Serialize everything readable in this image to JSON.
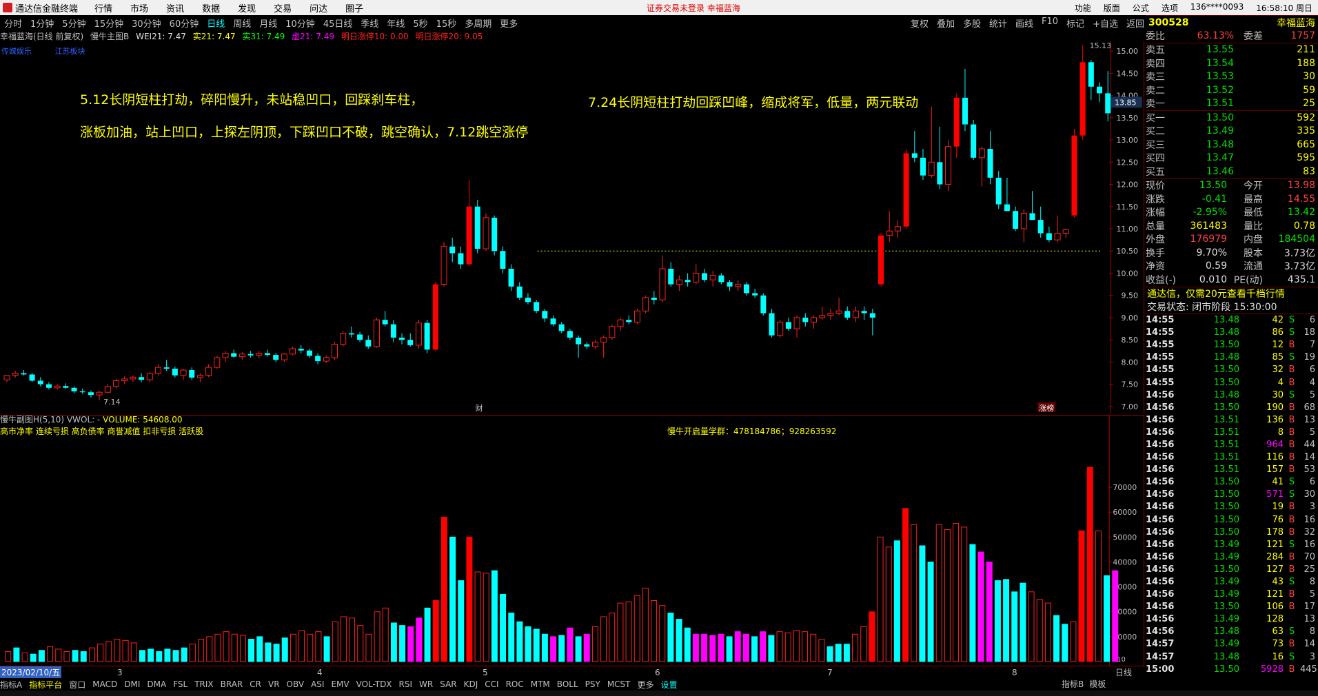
{
  "titlebar": {
    "app": "通达信金融终端",
    "menus": [
      "行情",
      "市场",
      "资讯",
      "数据",
      "发现",
      "交易",
      "问达",
      "圈子"
    ],
    "notice": "证券交易未登录  幸福蓝海",
    "right": [
      "功能",
      "版面",
      "公式",
      "选项",
      "136****0093",
      "16:58:10 周日"
    ]
  },
  "toolbar": {
    "periods": [
      "分时",
      "1分钟",
      "5分钟",
      "15分钟",
      "30分钟",
      "60分钟",
      "日线",
      "周线",
      "月线",
      "10分钟",
      "45日线",
      "季线",
      "年线",
      "5秒",
      "15秒",
      "多周期",
      "更多"
    ],
    "active": "日线",
    "right": [
      "复权",
      "叠加",
      "多股",
      "统计",
      "画线",
      "F10",
      "标记",
      "+自选",
      "返回"
    ]
  },
  "chart_info": {
    "name": "幸福蓝海(日线 前复权)",
    "indicator": "慢牛主图B",
    "wei21": "WEI21: 7.47",
    "shi21": "实21: 7.47",
    "shi31": "实31: 7.49",
    "xu21": "虚21: 7.49",
    "zt10": "明日涨停10: 0.00",
    "zt20": "明日涨停20: 9.05",
    "tags": [
      "传媒娱乐",
      "江苏板块"
    ]
  },
  "annotations": {
    "a1": "5.12长阴短柱打劫，碎阳慢升，未站稳凹口，回踩刹车柱，",
    "a2": "涨板加油，站上凹口，上探左阴顶，下踩凹口不破，跳空确认，7.12跳空涨停",
    "a3": "7.24长阴短柱打劫回踩凹峰，缩成将军，低量，两元联动"
  },
  "main_axis": {
    "ticks": [
      "15.00",
      "14.50",
      "14.00",
      "13.50",
      "13.00",
      "12.50",
      "12.00",
      "11.50",
      "11.00",
      "10.50",
      "10.00",
      "9.50",
      "9.00",
      "8.50",
      "8.00",
      "7.50",
      "7.00"
    ],
    "current_price_label": "13.85",
    "high_label": "15.13",
    "low_label": "7.14",
    "marker_cai": "财",
    "marker_zhangbang": "涨榜"
  },
  "sub_chart": {
    "title": "慢牛副图H(5,10)",
    "vol_label": "VWOL: -",
    "volume_label": "VOLUME: 54608.00",
    "line2": "高市净率 连续亏损 高负债率 商誉减值 扣非亏损 活跃股",
    "qq": "慢牛开启量学群：478184786；928263592",
    "ticks": [
      "70000",
      "60000",
      "50000",
      "40000",
      "30000",
      "20000",
      "10000"
    ],
    "unit": "X10"
  },
  "date_bar": {
    "current": "2023/02/10/五",
    "months": [
      "3",
      "4",
      "5",
      "6",
      "7",
      "8"
    ]
  },
  "indicator_tabs": [
    "指标A",
    "指标平台",
    "窗口",
    "MACD",
    "DMI",
    "DMA",
    "FSL",
    "TRIX",
    "BRAR",
    "CR",
    "VR",
    "OBV",
    "ASI",
    "EMV",
    "VOL-TDX",
    "RSI",
    "WR",
    "SAR",
    "KDJ",
    "CCI",
    "ROC",
    "MTM",
    "BOLL",
    "PSY",
    "MCST",
    "更多",
    "设置"
  ],
  "indicator_tabs_right": [
    "指标B",
    "模板",
    "日线"
  ],
  "quote": {
    "code": "300528",
    "name": "幸福蓝海",
    "weibi_label": "委比",
    "weibi": "63.13%",
    "weicha_label": "委差",
    "weicha": "1757",
    "asks": [
      {
        "label": "卖五",
        "price": "13.55",
        "vol": "211"
      },
      {
        "label": "卖四",
        "price": "13.54",
        "vol": "188"
      },
      {
        "label": "卖三",
        "price": "13.53",
        "vol": "30"
      },
      {
        "label": "卖二",
        "price": "13.52",
        "vol": "59"
      },
      {
        "label": "卖一",
        "price": "13.51",
        "vol": "25"
      }
    ],
    "bids": [
      {
        "label": "买一",
        "price": "13.50",
        "vol": "592"
      },
      {
        "label": "买二",
        "price": "13.49",
        "vol": "335"
      },
      {
        "label": "买三",
        "price": "13.48",
        "vol": "665"
      },
      {
        "label": "买四",
        "price": "13.47",
        "vol": "595"
      },
      {
        "label": "买五",
        "price": "13.46",
        "vol": "83"
      }
    ],
    "stats": [
      {
        "l1": "现价",
        "v1": "13.50",
        "l2": "今开",
        "v2": "13.98"
      },
      {
        "l1": "涨跌",
        "v1": "-0.41",
        "l2": "最高",
        "v2": "14.55"
      },
      {
        "l1": "涨幅",
        "v1": "-2.95%",
        "l2": "最低",
        "v2": "13.42"
      },
      {
        "l1": "总量",
        "v1": "361483",
        "l2": "量比",
        "v2": "0.78"
      },
      {
        "l1": "外盘",
        "v1": "176979",
        "l2": "内盘",
        "v2": "184504"
      },
      {
        "l1": "换手",
        "v1": "9.70%",
        "l2": "股本",
        "v2": "3.73亿"
      },
      {
        "l1": "净资",
        "v1": "0.59",
        "l2": "流通",
        "v2": "3.73亿"
      },
      {
        "l1": "收益(-)",
        "v1": "0.010",
        "l2": "PE(动)",
        "v2": "435.1"
      }
    ],
    "promo": "通达信，仅需20元查看千档行情",
    "trade_status": "交易状态: 闭市阶段 15:30:00"
  },
  "ticks": [
    {
      "t": "14:55",
      "p": "13.48",
      "v": "42",
      "bs": "S",
      "n": "6"
    },
    {
      "t": "14:55",
      "p": "13.48",
      "v": "86",
      "bs": "S",
      "n": "18"
    },
    {
      "t": "14:55",
      "p": "13.50",
      "v": "12",
      "bs": "B",
      "n": "7"
    },
    {
      "t": "14:55",
      "p": "13.48",
      "v": "85",
      "bs": "S",
      "n": "19"
    },
    {
      "t": "14:55",
      "p": "13.50",
      "v": "32",
      "bs": "B",
      "n": "6"
    },
    {
      "t": "14:55",
      "p": "13.50",
      "v": "4",
      "bs": "B",
      "n": "4"
    },
    {
      "t": "14:56",
      "p": "13.48",
      "v": "30",
      "bs": "S",
      "n": "5"
    },
    {
      "t": "14:56",
      "p": "13.50",
      "v": "190",
      "bs": "B",
      "n": "68"
    },
    {
      "t": "14:56",
      "p": "13.51",
      "v": "136",
      "bs": "B",
      "n": "13"
    },
    {
      "t": "14:56",
      "p": "13.51",
      "v": "8",
      "bs": "B",
      "n": "5"
    },
    {
      "t": "14:56",
      "p": "13.51",
      "v": "964",
      "bs": "B",
      "n": "44"
    },
    {
      "t": "14:56",
      "p": "13.51",
      "v": "116",
      "bs": "B",
      "n": "14"
    },
    {
      "t": "14:56",
      "p": "13.51",
      "v": "157",
      "bs": "B",
      "n": "53"
    },
    {
      "t": "14:56",
      "p": "13.50",
      "v": "41",
      "bs": "S",
      "n": "6"
    },
    {
      "t": "14:56",
      "p": "13.50",
      "v": "571",
      "bs": "S",
      "n": "30"
    },
    {
      "t": "14:56",
      "p": "13.50",
      "v": "19",
      "bs": "B",
      "n": "3"
    },
    {
      "t": "14:56",
      "p": "13.50",
      "v": "76",
      "bs": "B",
      "n": "16"
    },
    {
      "t": "14:56",
      "p": "13.50",
      "v": "178",
      "bs": "B",
      "n": "32"
    },
    {
      "t": "14:56",
      "p": "13.49",
      "v": "121",
      "bs": "S",
      "n": "16"
    },
    {
      "t": "14:56",
      "p": "13.49",
      "v": "284",
      "bs": "B",
      "n": "70"
    },
    {
      "t": "14:56",
      "p": "13.50",
      "v": "127",
      "bs": "B",
      "n": "25"
    },
    {
      "t": "14:56",
      "p": "13.49",
      "v": "43",
      "bs": "S",
      "n": "8"
    },
    {
      "t": "14:56",
      "p": "13.49",
      "v": "121",
      "bs": "B",
      "n": "5"
    },
    {
      "t": "14:56",
      "p": "13.50",
      "v": "106",
      "bs": "B",
      "n": "17"
    },
    {
      "t": "14:56",
      "p": "13.49",
      "v": "128",
      "bs": "",
      "n": "13"
    },
    {
      "t": "14:56",
      "p": "13.48",
      "v": "63",
      "bs": "S",
      "n": "8"
    },
    {
      "t": "14:57",
      "p": "13.49",
      "v": "73",
      "bs": "B",
      "n": "14"
    },
    {
      "t": "14:57",
      "p": "13.48",
      "v": "16",
      "bs": "S",
      "n": "3"
    },
    {
      "t": "15:00",
      "p": "13.50",
      "v": "5928",
      "bs": "B",
      "n": "445"
    }
  ],
  "colors": {
    "up": "#ff2020",
    "down": "#00ffff",
    "mag": "#ff00ff"
  },
  "candles": [
    [
      7.6,
      7.7,
      7.55,
      7.7
    ],
    [
      7.7,
      7.8,
      7.65,
      7.75
    ],
    [
      7.75,
      7.82,
      7.7,
      7.72
    ],
    [
      7.72,
      7.75,
      7.55,
      7.58
    ],
    [
      7.58,
      7.66,
      7.45,
      7.5
    ],
    [
      7.5,
      7.55,
      7.38,
      7.42
    ],
    [
      7.42,
      7.5,
      7.38,
      7.46
    ],
    [
      7.46,
      7.52,
      7.4,
      7.42
    ],
    [
      7.42,
      7.45,
      7.3,
      7.34
    ],
    [
      7.34,
      7.4,
      7.28,
      7.32
    ],
    [
      7.32,
      7.36,
      7.2,
      7.26
    ],
    [
      7.26,
      7.35,
      7.14,
      7.32
    ],
    [
      7.32,
      7.5,
      7.3,
      7.45
    ],
    [
      7.45,
      7.62,
      7.4,
      7.58
    ],
    [
      7.58,
      7.68,
      7.5,
      7.62
    ],
    [
      7.62,
      7.7,
      7.55,
      7.66
    ],
    [
      7.66,
      7.75,
      7.55,
      7.6
    ],
    [
      7.6,
      7.78,
      7.55,
      7.74
    ],
    [
      7.74,
      7.95,
      7.7,
      7.88
    ],
    [
      7.88,
      8.05,
      7.8,
      7.85
    ],
    [
      7.85,
      7.9,
      7.65,
      7.7
    ],
    [
      7.7,
      7.85,
      7.6,
      7.82
    ],
    [
      7.82,
      7.88,
      7.6,
      7.65
    ],
    [
      7.65,
      7.75,
      7.55,
      7.7
    ],
    [
      7.7,
      7.95,
      7.66,
      7.88
    ],
    [
      7.88,
      8.15,
      7.85,
      8.1
    ],
    [
      8.1,
      8.25,
      8.0,
      8.2
    ],
    [
      8.2,
      8.28,
      8.1,
      8.12
    ],
    [
      8.12,
      8.22,
      8.05,
      8.18
    ],
    [
      8.18,
      8.25,
      8.1,
      8.15
    ],
    [
      8.15,
      8.25,
      8.08,
      8.2
    ],
    [
      8.2,
      8.28,
      8.12,
      8.16
    ],
    [
      8.16,
      8.2,
      8.0,
      8.05
    ],
    [
      8.05,
      8.2,
      8.0,
      8.18
    ],
    [
      8.18,
      8.35,
      8.15,
      8.3
    ],
    [
      8.3,
      8.38,
      8.2,
      8.26
    ],
    [
      8.26,
      8.3,
      8.1,
      8.14
    ],
    [
      8.14,
      8.2,
      7.95,
      8.02
    ],
    [
      8.02,
      8.15,
      7.98,
      8.1
    ],
    [
      8.1,
      8.45,
      8.05,
      8.4
    ],
    [
      8.4,
      8.7,
      8.35,
      8.65
    ],
    [
      8.65,
      8.8,
      8.55,
      8.62
    ],
    [
      8.62,
      8.68,
      8.45,
      8.5
    ],
    [
      8.5,
      8.6,
      8.3,
      8.35
    ],
    [
      8.35,
      9.0,
      8.32,
      8.95
    ],
    [
      8.95,
      9.15,
      8.8,
      8.85
    ],
    [
      8.85,
      8.95,
      8.45,
      8.55
    ],
    [
      8.55,
      8.65,
      8.4,
      8.5
    ],
    [
      8.5,
      8.65,
      8.35,
      8.38
    ],
    [
      8.38,
      8.95,
      8.3,
      8.88
    ],
    [
      8.88,
      8.95,
      8.2,
      8.28
    ],
    [
      8.28,
      9.8,
      8.25,
      9.75
    ],
    [
      9.75,
      10.7,
      9.7,
      10.6
    ],
    [
      10.6,
      10.8,
      10.25,
      10.45
    ],
    [
      10.45,
      10.6,
      10.1,
      10.2
    ],
    [
      10.2,
      12.1,
      10.15,
      11.5
    ],
    [
      11.5,
      11.65,
      10.45,
      10.55
    ],
    [
      10.55,
      11.35,
      10.5,
      11.25
    ],
    [
      11.25,
      11.3,
      10.4,
      10.5
    ],
    [
      10.5,
      10.6,
      10.0,
      10.1
    ],
    [
      10.1,
      10.2,
      9.6,
      9.7
    ],
    [
      9.7,
      9.8,
      9.4,
      9.45
    ],
    [
      9.45,
      9.55,
      9.3,
      9.35
    ],
    [
      9.35,
      9.4,
      9.1,
      9.15
    ],
    [
      9.15,
      9.2,
      8.9,
      8.98
    ],
    [
      8.98,
      9.05,
      8.8,
      8.85
    ],
    [
      8.85,
      8.9,
      8.65,
      8.7
    ],
    [
      8.7,
      8.75,
      8.5,
      8.55
    ],
    [
      8.55,
      8.6,
      8.1,
      8.4
    ],
    [
      8.4,
      8.45,
      8.3,
      8.35
    ],
    [
      8.35,
      8.5,
      8.3,
      8.45
    ],
    [
      8.45,
      8.6,
      8.1,
      8.55
    ],
    [
      8.55,
      8.85,
      8.5,
      8.8
    ],
    [
      8.8,
      9.0,
      8.7,
      8.95
    ],
    [
      8.95,
      9.05,
      8.85,
      8.9
    ],
    [
      8.9,
      9.2,
      8.85,
      9.15
    ],
    [
      9.15,
      9.5,
      9.1,
      9.45
    ],
    [
      9.45,
      9.6,
      9.3,
      9.4
    ],
    [
      9.4,
      10.4,
      9.35,
      10.1
    ],
    [
      10.1,
      10.25,
      9.7,
      9.75
    ],
    [
      9.75,
      9.95,
      9.6,
      9.85
    ],
    [
      9.85,
      10.0,
      9.7,
      9.8
    ],
    [
      9.8,
      10.2,
      9.75,
      10.0
    ],
    [
      10.0,
      10.1,
      9.8,
      9.85
    ],
    [
      9.85,
      10.05,
      9.7,
      9.95
    ],
    [
      9.95,
      10.0,
      9.75,
      9.8
    ],
    [
      9.8,
      9.85,
      9.6,
      9.7
    ],
    [
      9.7,
      9.85,
      9.6,
      9.75
    ],
    [
      9.75,
      9.8,
      9.5,
      9.55
    ],
    [
      9.55,
      9.65,
      9.45,
      9.5
    ],
    [
      9.5,
      9.55,
      9.05,
      9.1
    ],
    [
      9.1,
      9.2,
      8.55,
      8.6
    ],
    [
      8.6,
      8.95,
      8.55,
      8.9
    ],
    [
      8.9,
      9.0,
      8.7,
      8.75
    ],
    [
      8.75,
      9.05,
      8.55,
      9.0
    ],
    [
      9.0,
      9.1,
      8.8,
      8.9
    ],
    [
      8.9,
      9.05,
      8.75,
      9.0
    ],
    [
      9.0,
      9.25,
      8.95,
      9.05
    ],
    [
      9.05,
      9.2,
      8.95,
      9.1
    ],
    [
      9.1,
      9.45,
      9.05,
      9.15
    ],
    [
      9.15,
      9.25,
      8.95,
      9.0
    ],
    [
      9.0,
      9.25,
      8.9,
      9.15
    ],
    [
      9.15,
      9.25,
      8.95,
      9.1
    ],
    [
      9.1,
      9.2,
      8.6,
      9.0
    ],
    [
      9.75,
      10.9,
      9.7,
      10.85
    ],
    [
      10.85,
      11.4,
      10.7,
      10.95
    ],
    [
      10.95,
      11.2,
      10.8,
      11.05
    ],
    [
      11.05,
      12.8,
      11.0,
      12.7
    ],
    [
      12.7,
      13.2,
      12.5,
      12.6
    ],
    [
      12.6,
      12.8,
      12.1,
      12.2
    ],
    [
      12.2,
      13.75,
      12.15,
      12.5
    ],
    [
      12.5,
      13.3,
      11.9,
      12.0
    ],
    [
      12.0,
      13.0,
      11.85,
      12.85
    ],
    [
      12.85,
      14.05,
      12.6,
      13.95
    ],
    [
      13.95,
      14.6,
      13.2,
      13.35
    ],
    [
      13.35,
      13.45,
      12.55,
      12.6
    ],
    [
      12.6,
      12.85,
      11.95,
      12.8
    ],
    [
      12.8,
      13.2,
      12.0,
      12.15
    ],
    [
      12.15,
      12.3,
      11.45,
      11.55
    ],
    [
      11.55,
      12.15,
      11.5,
      11.4
    ],
    [
      11.4,
      11.5,
      10.95,
      11.0
    ],
    [
      11.0,
      11.45,
      10.7,
      11.35
    ],
    [
      11.35,
      11.85,
      11.2,
      11.2
    ],
    [
      11.2,
      11.5,
      10.8,
      10.9
    ],
    [
      10.9,
      11.05,
      10.7,
      10.75
    ],
    [
      10.75,
      11.3,
      10.7,
      10.9
    ],
    [
      10.9,
      11.0,
      10.8,
      10.98
    ],
    [
      11.3,
      13.25,
      11.25,
      13.1
    ],
    [
      13.1,
      15.13,
      13.0,
      14.75
    ],
    [
      14.75,
      14.8,
      13.9,
      14.2
    ],
    [
      14.2,
      14.3,
      13.85,
      14.05
    ],
    [
      14.05,
      14.55,
      13.42,
      13.6
    ]
  ],
  "volumes": [
    [
      0.4,
      "r"
    ],
    [
      0.55,
      "c"
    ],
    [
      0.35,
      "r"
    ],
    [
      0.3,
      "c"
    ],
    [
      0.45,
      "c"
    ],
    [
      0.6,
      "r"
    ],
    [
      0.5,
      "r"
    ],
    [
      0.4,
      "r"
    ],
    [
      0.45,
      "c"
    ],
    [
      0.4,
      "c"
    ],
    [
      0.55,
      "r"
    ],
    [
      0.7,
      "r"
    ],
    [
      0.8,
      "r"
    ],
    [
      0.9,
      "r"
    ],
    [
      0.85,
      "r"
    ],
    [
      0.75,
      "r"
    ],
    [
      0.45,
      "c"
    ],
    [
      0.5,
      "c"
    ],
    [
      0.4,
      "c"
    ],
    [
      0.5,
      "c"
    ],
    [
      0.45,
      "c"
    ],
    [
      0.55,
      "c"
    ],
    [
      0.7,
      "r"
    ],
    [
      0.9,
      "r"
    ],
    [
      1.0,
      "r"
    ],
    [
      1.1,
      "r"
    ],
    [
      1.2,
      "r"
    ],
    [
      1.1,
      "r"
    ],
    [
      1.05,
      "r"
    ],
    [
      0.9,
      "c"
    ],
    [
      1.0,
      "c"
    ],
    [
      0.75,
      "c"
    ],
    [
      0.7,
      "c"
    ],
    [
      0.95,
      "c"
    ],
    [
      1.1,
      "r"
    ],
    [
      1.25,
      "r"
    ],
    [
      1.1,
      "r"
    ],
    [
      1.2,
      "r"
    ],
    [
      1.0,
      "c"
    ],
    [
      1.6,
      "r"
    ],
    [
      1.8,
      "r"
    ],
    [
      1.75,
      "r"
    ],
    [
      1.45,
      "r"
    ],
    [
      1.1,
      "r"
    ],
    [
      2.0,
      "r"
    ],
    [
      2.15,
      "r"
    ],
    [
      1.55,
      "c"
    ],
    [
      1.45,
      "c"
    ],
    [
      1.4,
      "m"
    ],
    [
      1.75,
      "m"
    ],
    [
      2.15,
      "c"
    ],
    [
      2.45,
      "up"
    ],
    [
      5.8,
      "up"
    ],
    [
      5.0,
      "c"
    ],
    [
      3.25,
      "c"
    ],
    [
      5.0,
      "up"
    ],
    [
      3.6,
      "r"
    ],
    [
      3.55,
      "r"
    ],
    [
      3.65,
      "c"
    ],
    [
      2.7,
      "c"
    ],
    [
      1.95,
      "c"
    ],
    [
      1.6,
      "c"
    ],
    [
      1.4,
      "c"
    ],
    [
      1.3,
      "c"
    ],
    [
      1.1,
      "c"
    ],
    [
      1.0,
      "m"
    ],
    [
      1.05,
      "c"
    ],
    [
      1.35,
      "m"
    ],
    [
      1.0,
      "c"
    ],
    [
      1.1,
      "m"
    ],
    [
      1.4,
      "r"
    ],
    [
      1.8,
      "r"
    ],
    [
      1.95,
      "r"
    ],
    [
      2.35,
      "r"
    ],
    [
      2.4,
      "r"
    ],
    [
      2.65,
      "r"
    ],
    [
      2.95,
      "r"
    ],
    [
      2.45,
      "r"
    ],
    [
      2.25,
      "r"
    ],
    [
      1.95,
      "c"
    ],
    [
      1.7,
      "c"
    ],
    [
      1.35,
      "c"
    ],
    [
      1.1,
      "m"
    ],
    [
      1.1,
      "m"
    ],
    [
      1.05,
      "m"
    ],
    [
      1.1,
      "m"
    ],
    [
      1.0,
      "c"
    ],
    [
      1.2,
      "m"
    ],
    [
      1.1,
      "m"
    ],
    [
      1.0,
      "c"
    ],
    [
      1.2,
      "m"
    ],
    [
      1.05,
      "c"
    ],
    [
      1.2,
      "r"
    ],
    [
      1.15,
      "r"
    ],
    [
      1.25,
      "r"
    ],
    [
      1.2,
      "r"
    ],
    [
      1.1,
      "r"
    ],
    [
      0.9,
      "r"
    ],
    [
      0.6,
      "c"
    ],
    [
      0.7,
      "c"
    ],
    [
      0.7,
      "c"
    ],
    [
      1.1,
      "r"
    ],
    [
      1.4,
      "r"
    ],
    [
      2.0,
      "up"
    ],
    [
      5.0,
      "r"
    ],
    [
      4.6,
      "r"
    ],
    [
      4.85,
      "c"
    ],
    [
      6.15,
      "up"
    ],
    [
      5.5,
      "r"
    ],
    [
      4.65,
      "c"
    ],
    [
      4.0,
      "c"
    ],
    [
      5.5,
      "r"
    ],
    [
      5.3,
      "r"
    ],
    [
      5.55,
      "r"
    ],
    [
      5.4,
      "r"
    ],
    [
      4.7,
      "c"
    ],
    [
      4.4,
      "m"
    ],
    [
      4.0,
      "m"
    ],
    [
      3.25,
      "c"
    ],
    [
      3.3,
      "c"
    ],
    [
      2.8,
      "c"
    ],
    [
      3.15,
      "c"
    ],
    [
      2.8,
      "r"
    ],
    [
      2.5,
      "r"
    ],
    [
      2.35,
      "r"
    ],
    [
      1.85,
      "c"
    ],
    [
      1.5,
      "c"
    ],
    [
      1.6,
      "r"
    ],
    [
      5.25,
      "up"
    ],
    [
      7.8,
      "up"
    ],
    [
      5.25,
      "r"
    ],
    [
      3.45,
      "c"
    ],
    [
      3.65,
      "m"
    ]
  ]
}
